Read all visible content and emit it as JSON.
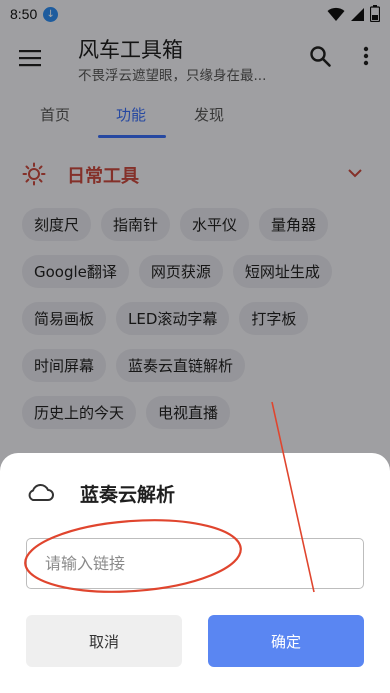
{
  "status_bar": {
    "time": "8:50"
  },
  "app_bar": {
    "title": "风车工具箱",
    "subtitle": "不畏浮云遮望眼，只缘身在最..."
  },
  "tabs": [
    {
      "label": "首页",
      "active": false
    },
    {
      "label": "功能",
      "active": true
    },
    {
      "label": "发现",
      "active": false
    }
  ],
  "section": {
    "title": "日常工具",
    "chips": [
      [
        "刻度尺",
        "指南针",
        "水平仪",
        "量角器"
      ],
      [
        "Google翻译",
        "网页获源",
        "短网址生成"
      ],
      [
        "简易画板",
        "LED滚动字幕",
        "打字板"
      ],
      [
        "时间屏幕",
        "蓝奏云直链解析"
      ],
      [
        "历史上的今天",
        "电视直播"
      ]
    ]
  },
  "dialog": {
    "title": "蓝奏云解析",
    "input_value": "",
    "input_placeholder": "请输入链接",
    "cancel_label": "取消",
    "confirm_label": "确定"
  },
  "colors": {
    "accent": "#3a6ef5",
    "confirm_button": "#5a86f2",
    "section_title": "#c94a3f",
    "annotation": "#e0452e"
  },
  "icons": [
    "download-icon",
    "wifi-icon",
    "signal-icon",
    "battery-icon",
    "menu-icon",
    "search-icon",
    "more-vert-icon",
    "sun-icon",
    "chevron-down-icon",
    "cloud-icon"
  ]
}
